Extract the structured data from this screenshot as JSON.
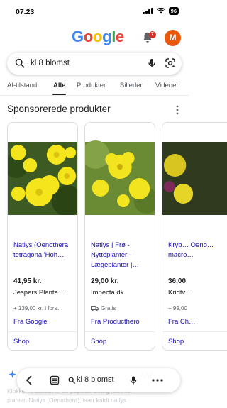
{
  "status_bar": {
    "time": "07.23",
    "battery": "96"
  },
  "header": {
    "logo_letters": [
      {
        "char": "G",
        "color": "#4285F4"
      },
      {
        "char": "o",
        "color": "#EA4335"
      },
      {
        "char": "o",
        "color": "#FBBC05"
      },
      {
        "char": "g",
        "color": "#4285F4"
      },
      {
        "char": "l",
        "color": "#34A853"
      },
      {
        "char": "e",
        "color": "#EA4335"
      }
    ],
    "notification_count": "7",
    "avatar_initial": "M"
  },
  "search": {
    "query": "kl 8 blomst"
  },
  "tabs": [
    {
      "label": "AI-tilstand"
    },
    {
      "label": "Alle"
    },
    {
      "label": "Produkter"
    },
    {
      "label": "Billeder"
    },
    {
      "label": "Videoer"
    }
  ],
  "section": {
    "title": "Sponsorerede produkter"
  },
  "products": [
    {
      "title": "Natlys (Oenothera tetragona 'Hoh…",
      "price": "41,95 kr.",
      "store": "Jespers Plante…",
      "shipping": "+ 139,00 kr. i fors…",
      "source": "Fra Google",
      "shop": "Shop"
    },
    {
      "title": "Natlys | Frø - Nytteplanter - Lægeplanter |…",
      "price": "29,00 kr.",
      "store": "Impecta.dk",
      "shipping": "Gratis",
      "source": "Fra Producthero",
      "shop": "Shop"
    },
    {
      "title": "Kryb… Oeno… macro…",
      "price": "36,00",
      "store": "Kridtv…",
      "shipping": "+ 99,00",
      "source": "Fra Ch…",
      "shop": "Shop"
    }
  ],
  "ai_overview": {
    "line1": "Klokken 8 blomst er en populær betegnelse for",
    "line2": "planten Natlys (Oenothera), især kaldt natlys"
  },
  "bottom_bar": {
    "query": "kl 8 blomst"
  },
  "colors": {
    "brand_blue": "#1a0dab",
    "badge_red": "#d93025",
    "avatar_orange": "#e8590c"
  }
}
